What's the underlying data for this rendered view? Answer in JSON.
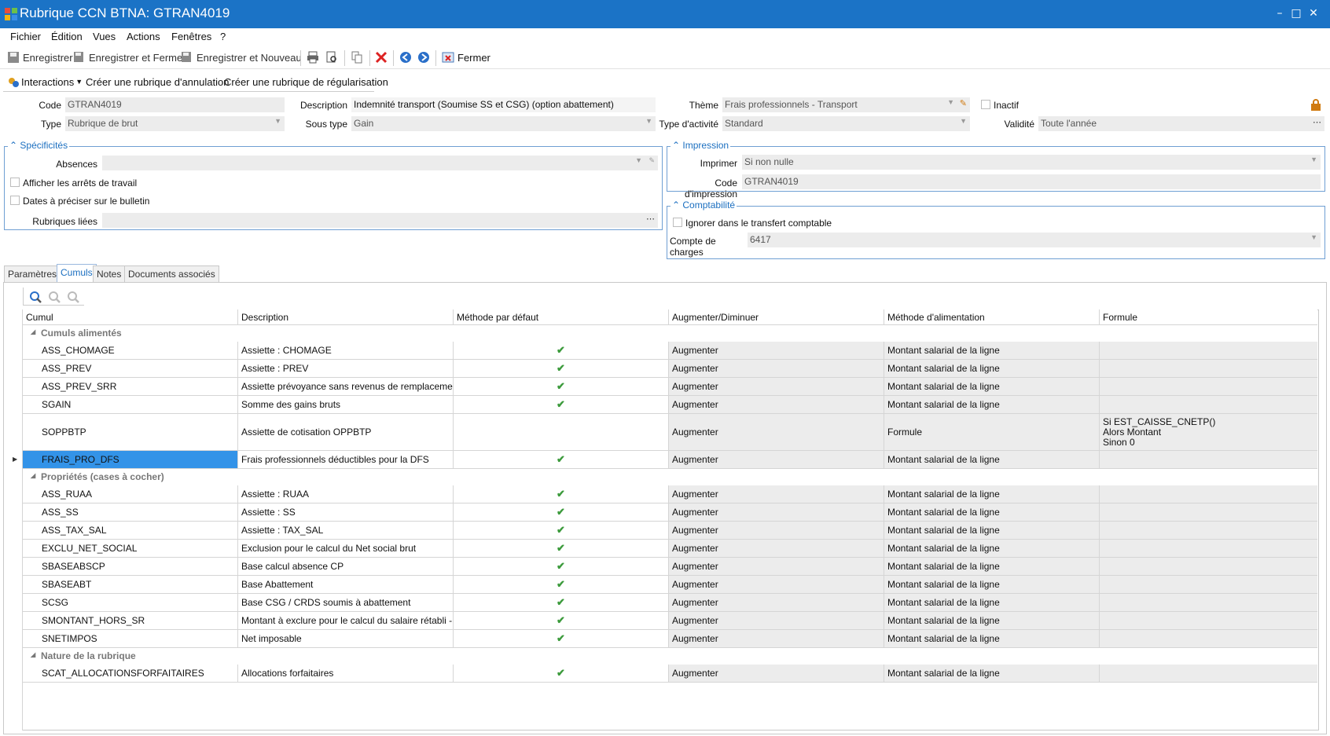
{
  "window": {
    "title": "Rubrique CCN BTNA: GTRAN4019"
  },
  "menu": [
    "Fichier",
    "Édition",
    "Vues",
    "Actions",
    "Fenêtres",
    "?"
  ],
  "toolbar": {
    "save": "Enregistrer",
    "save_close": "Enregistrer et Fermer",
    "save_new": "Enregistrer et Nouveau",
    "close": "Fermer"
  },
  "actions": {
    "interactions": "Interactions",
    "cancel_rubric": "Créer une rubrique d'annulation",
    "regul_rubric": "Créer une rubrique de régularisation"
  },
  "form": {
    "code_label": "Code",
    "code": "GTRAN4019",
    "type_label": "Type",
    "type": "Rubrique de brut",
    "description_label": "Description",
    "description": "Indemnité transport (Soumise SS et CSG) (option abattement)",
    "subtype_label": "Sous type",
    "subtype": "Gain",
    "theme_label": "Thème",
    "theme": "Frais professionnels - Transport",
    "activity_label": "Type d'activité",
    "activity": "Standard",
    "inactive_label": "Inactif",
    "validity_label": "Validité",
    "validity": "Toute l'année"
  },
  "specificities": {
    "title": "Spécificités",
    "absences_label": "Absences",
    "show_stops": "Afficher les arrêts de travail",
    "dates_bulletin": "Dates à préciser sur le bulletin",
    "linked_label": "Rubriques liées"
  },
  "printing": {
    "title": "Impression",
    "print_label": "Imprimer",
    "print_value": "Si non nulle",
    "code_label": "Code d'impression",
    "code_value": "GTRAN4019"
  },
  "accounting": {
    "title": "Comptabilité",
    "ignore_label": "Ignorer dans le transfert comptable",
    "charges_label": "Compte de charges",
    "charges_value": "6417"
  },
  "tabs": [
    "Paramètres",
    "Cumuls",
    "Notes",
    "Documents associés"
  ],
  "grid": {
    "headers": [
      "Cumul",
      "Description",
      "Méthode par défaut",
      "Augmenter/Diminuer",
      "Méthode d'alimentation",
      "Formule"
    ],
    "groups": [
      {
        "title": "Cumuls alimentés"
      },
      {
        "title": "Propriétés (cases à cocher)"
      },
      {
        "title": "Nature de la rubrique"
      }
    ],
    "rows": [
      {
        "cumul": "ASS_CHOMAGE",
        "desc": "Assiette : CHOMAGE",
        "default": "✔",
        "dir": "Augmenter",
        "method": "Montant salarial de la ligne",
        "formula": ""
      },
      {
        "cumul": "ASS_PREV",
        "desc": "Assiette : PREV",
        "default": "✔",
        "dir": "Augmenter",
        "method": "Montant salarial de la ligne",
        "formula": ""
      },
      {
        "cumul": "ASS_PREV_SRR",
        "desc": "Assiette prévoyance sans revenus de remplacement",
        "default": "✔",
        "dir": "Augmenter",
        "method": "Montant salarial de la ligne",
        "formula": ""
      },
      {
        "cumul": "SGAIN",
        "desc": "Somme des gains bruts",
        "default": "✔",
        "dir": "Augmenter",
        "method": "Montant salarial de la ligne",
        "formula": ""
      },
      {
        "cumul": "SOPPBTP",
        "desc": "Assiette de cotisation OPPBTP",
        "default": "",
        "dir": "Augmenter",
        "method": "Formule",
        "formula": "Si EST_CAISSE_CNETP()\nAlors Montant\nSinon 0"
      },
      {
        "cumul": "FRAIS_PRO_DFS",
        "desc": "Frais professionnels déductibles pour la DFS",
        "default": "✔",
        "dir": "Augmenter",
        "method": "Montant salarial de la ligne",
        "formula": ""
      },
      {
        "cumul": "ASS_RUAA",
        "desc": "Assiette : RUAA",
        "default": "✔",
        "dir": "Augmenter",
        "method": "Montant salarial de la ligne",
        "formula": ""
      },
      {
        "cumul": "ASS_SS",
        "desc": "Assiette : SS",
        "default": "✔",
        "dir": "Augmenter",
        "method": "Montant salarial de la ligne",
        "formula": ""
      },
      {
        "cumul": "ASS_TAX_SAL",
        "desc": "Assiette : TAX_SAL",
        "default": "✔",
        "dir": "Augmenter",
        "method": "Montant salarial de la ligne",
        "formula": ""
      },
      {
        "cumul": "EXCLU_NET_SOCIAL",
        "desc": "Exclusion pour le calcul du Net social brut",
        "default": "✔",
        "dir": "Augmenter",
        "method": "Montant salarial de la ligne",
        "formula": ""
      },
      {
        "cumul": "SBASEABSCP",
        "desc": "Base calcul absence CP",
        "default": "✔",
        "dir": "Augmenter",
        "method": "Montant salarial de la ligne",
        "formula": ""
      },
      {
        "cumul": "SBASEABT",
        "desc": "Base Abattement",
        "default": "✔",
        "dir": "Augmenter",
        "method": "Montant salarial de la ligne",
        "formula": ""
      },
      {
        "cumul": "SCSG",
        "desc": "Base CSG / CRDS soumis à abattement",
        "default": "✔",
        "dir": "Augmenter",
        "method": "Montant salarial de la ligne",
        "formula": ""
      },
      {
        "cumul": "SMONTANT_HORS_SR",
        "desc": "Montant à exclure pour le calcul du salaire rétabli - re...",
        "default": "✔",
        "dir": "Augmenter",
        "method": "Montant salarial de la ligne",
        "formula": ""
      },
      {
        "cumul": "SNETIMPOS",
        "desc": "Net imposable",
        "default": "✔",
        "dir": "Augmenter",
        "method": "Montant salarial de la ligne",
        "formula": ""
      },
      {
        "cumul": "SCAT_ALLOCATIONSFORFAITAIRES",
        "desc": "Allocations forfaitaires",
        "default": "✔",
        "dir": "Augmenter",
        "method": "Montant salarial de la ligne",
        "formula": ""
      }
    ]
  }
}
